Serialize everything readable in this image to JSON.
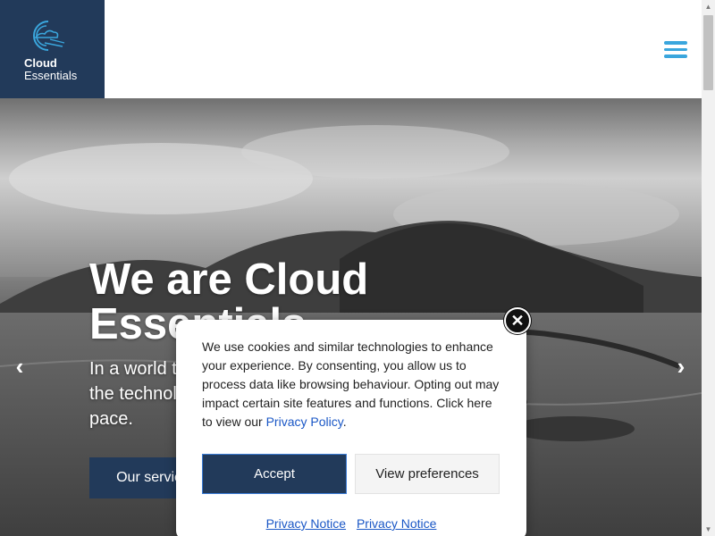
{
  "brand": {
    "line1": "Cloud",
    "line2": "Essentials",
    "color": "#223a5a",
    "accent": "#3aa6dd"
  },
  "header": {
    "menu_icon": "hamburger-menu-icon"
  },
  "hero": {
    "title_line1": "We are Cloud",
    "title_line2": "Essentials",
    "subtitle_line1": "In a world that moves fast, we keep you ahead with",
    "subtitle_line2": "the technology and services you need to set off the",
    "subtitle_line3": "pace.",
    "button_label": "Our services",
    "prev_icon": "chevron-left-icon",
    "next_icon": "chevron-right-icon"
  },
  "cookie_modal": {
    "text": "We use cookies and similar technologies to enhance your experience. By consenting, you allow us to process data like browsing behaviour. Opting out may impact certain site features and functions. Click here to view our ",
    "policy_link": "Privacy Policy",
    "text_end": ".",
    "accept_label": "Accept",
    "preferences_label": "View preferences",
    "footer_links": [
      "Privacy Notice",
      "Privacy Notice"
    ],
    "close_icon": "close-icon"
  }
}
